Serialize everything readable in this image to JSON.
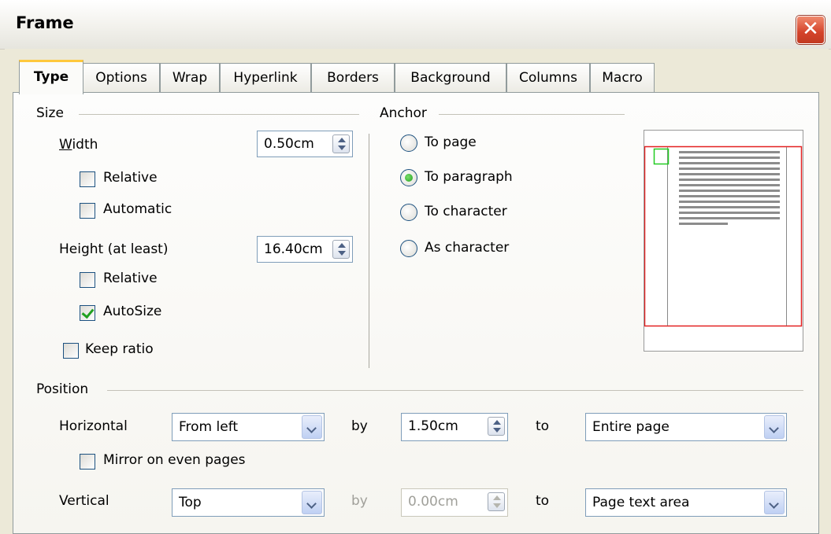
{
  "window": {
    "title": "Frame"
  },
  "tabs": [
    "Type",
    "Options",
    "Wrap",
    "Hyperlink",
    "Borders",
    "Background",
    "Columns",
    "Macro"
  ],
  "size": {
    "group_label": "Size",
    "width_label": "Width",
    "width_value": "0.50cm",
    "width_relative_label": "Relative",
    "width_relative_checked": false,
    "width_automatic_label": "Automatic",
    "width_automatic_checked": false,
    "height_label": "Height (at least)",
    "height_value": "16.40cm",
    "height_relative_label": "Relative",
    "height_relative_checked": false,
    "autosize_label": "AutoSize",
    "autosize_checked": true,
    "keep_ratio_label": "Keep ratio",
    "keep_ratio_checked": false
  },
  "anchor": {
    "group_label": "Anchor",
    "options": [
      "To page",
      "To paragraph",
      "To character",
      "As character"
    ],
    "selected": "To paragraph"
  },
  "position": {
    "group_label": "Position",
    "horizontal_label": "Horizontal",
    "horizontal_value": "From left",
    "h_by_label": "by",
    "h_by_value": "1.50cm",
    "h_to_label": "to",
    "h_to_value": "Entire page",
    "mirror_label": "Mirror on even pages",
    "mirror_checked": false,
    "vertical_label": "Vertical",
    "vertical_value": "Top",
    "v_by_label": "by",
    "v_by_value": "0.00cm",
    "v_to_label": "to",
    "v_to_value": "Page text area"
  },
  "colors": {
    "accent_tab": "#FFC83C",
    "check_green": "#21A121",
    "preview_red": "#E32020",
    "preview_green": "#22CC22"
  }
}
